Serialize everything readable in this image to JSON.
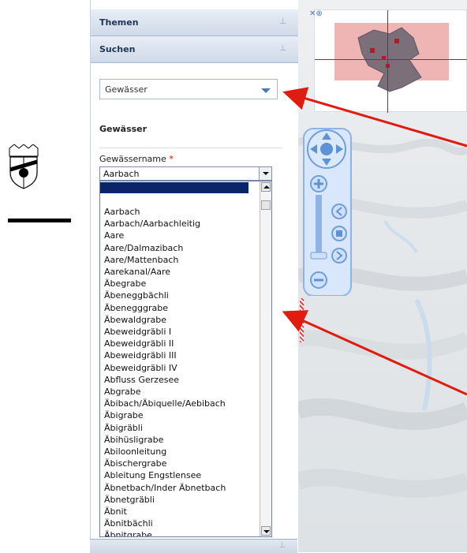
{
  "panel": {
    "headers": [
      {
        "label": "Themen"
      },
      {
        "label": "Suchen"
      }
    ],
    "search_type": {
      "value": "Gewässer"
    },
    "section_title": "Gewässer",
    "field": {
      "label": "Gewässername",
      "required_marker": "*"
    },
    "combo": {
      "value": "Aarbach"
    },
    "list": [
      "Aarbach",
      "Aarbach/Aarbachleitig",
      "Aare",
      "Aare/Dalmazibach",
      "Aare/Mattenbach",
      "Aarekanal/Aare",
      "Äbegrabe",
      "Äbeneggbächli",
      "Äbenegggrabe",
      "Äbewaldgrabe",
      "Abeweidgräbli I",
      "Abeweidgräbli II",
      "Abeweidgräbli III",
      "Abeweidgräbli IV",
      "Abfluss Gerzesee",
      "Abgrabe",
      "Äbibach/Äbiquelle/Aebibach",
      "Äbigrabe",
      "Äbigräbli",
      "Äbihüsligrabe",
      "Abiloonleitung",
      "Äbischergrabe",
      "Ableitung Engstlensee",
      "Äbnetbach/Inder Äbnetbach",
      "Äbnetgräbli",
      "Äbnit",
      "Äbnitbächli",
      "Äbnitgrabe"
    ]
  },
  "icons": {
    "pin": "pin-icon",
    "overview_controls": "overview-controls-icon"
  },
  "colors": {
    "panel_header": "#cfd9e8",
    "accent_blue": "#4a79b8",
    "arrow_red": "#e01b0f",
    "selection": "#0a246a"
  }
}
